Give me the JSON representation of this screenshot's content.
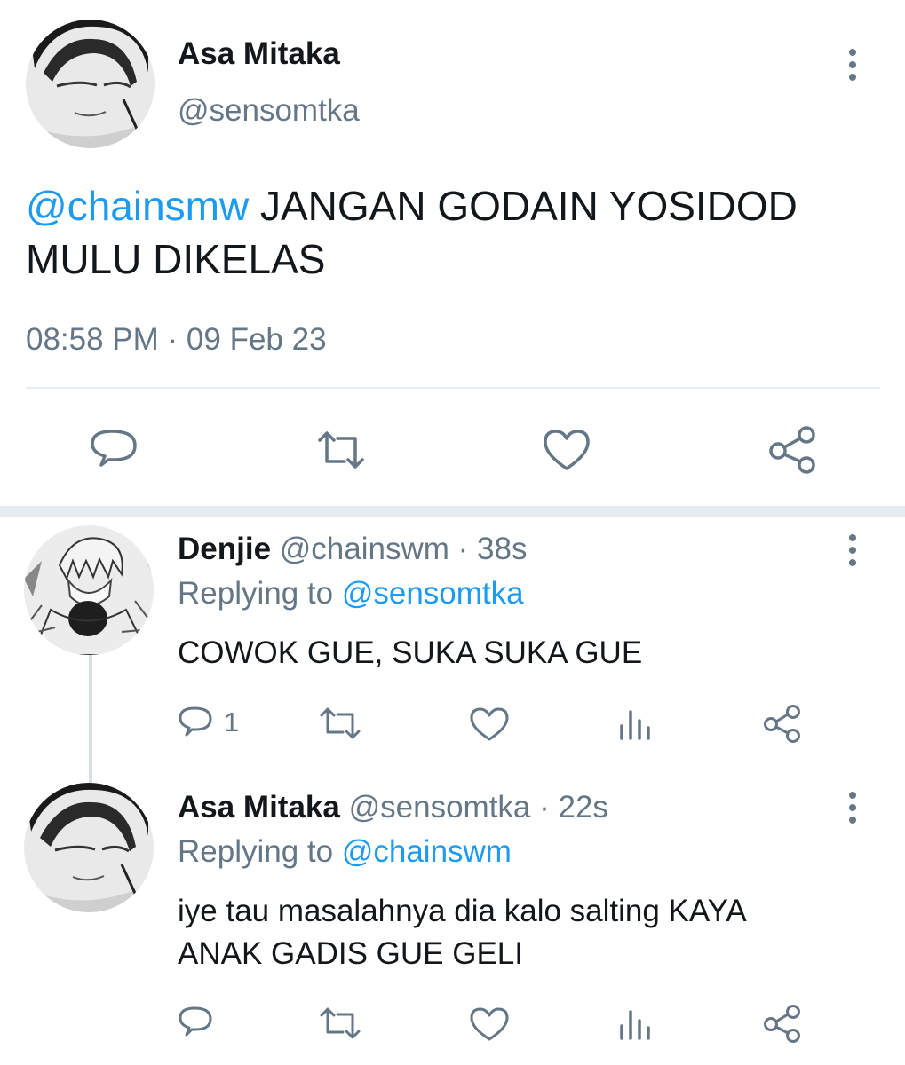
{
  "main_tweet": {
    "author_name": "Asa Mitaka",
    "author_handle": "@sensomtka",
    "mention": "@chainsmw",
    "text_line1": " JANGAN GODAIN YOSIDOD",
    "text_line2": "MULU DIKELAS",
    "timestamp": "08:58 PM · 09 Feb 23",
    "actions": [
      "reply-icon",
      "retweet-icon",
      "like-icon",
      "share-icon"
    ]
  },
  "replies": [
    {
      "author_name": "Denjie",
      "author_handle": "@chainswm",
      "age": " · 38s",
      "replying_label": "Replying to ",
      "replying_to": "@sensomtka",
      "text_line1": "COWOK GUE, SUKA SUKA GUE",
      "text_line2": "",
      "reply_count": "1"
    },
    {
      "author_name": "Asa Mitaka",
      "author_handle": "@sensomtka",
      "age": " · 22s",
      "replying_label": "Replying to ",
      "replying_to": "@chainswm",
      "text_line1": "iye tau masalahnya dia kalo salting KAYA",
      "text_line2": "ANAK GADIS GUE GELI",
      "reply_count": ""
    }
  ],
  "colors": {
    "link": "#1d9bf0",
    "muted": "#657786",
    "text": "#14171a",
    "separator": "#e6ecf0"
  }
}
